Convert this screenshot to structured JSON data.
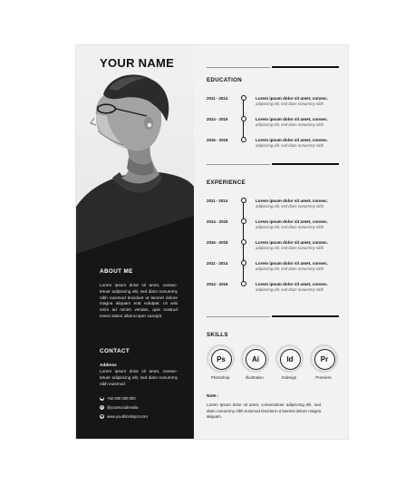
{
  "name": "YOUR NAME",
  "about": {
    "title": "ABOUT ME",
    "text": "Lorem ipsum dolor sit amet, consec-tetuer adipiscing elit, sed diam nonummy nibh euismod tincidunt ut laoreet dolore magna aliquam erat volutpat. Ut wisi enim ad minim veniam, quis nostrud exerci tation ullamcorper suscipit."
  },
  "contact": {
    "title": "CONTACT",
    "address_label": "Address",
    "address_text": "Lorem ipsum dolor sit amet, consec-tetuer adipiscing elit, sed diam nonummy nibh euismod",
    "phone": "+62 000 000 000",
    "social": "@yoursocialmedia",
    "website": "www.yourblockspot.com"
  },
  "education": {
    "title": "EDUCATION",
    "entries": [
      {
        "date": "2011 - 2014",
        "title": "Lorem ipsum dolor sit amet, consec.",
        "desc": "adipiscing elit, sed diam nonummy nibh"
      },
      {
        "date": "2014 - 2016",
        "title": "Lorem ipsum dolor sit amet, consec.",
        "desc": "adipiscing elit, sed diam nonummy nibh"
      },
      {
        "date": "2016 - 2018",
        "title": "Lorem ipsum dolor sit amet, consec.",
        "desc": "adipiscing elit, sed diam nonummy nibh"
      }
    ]
  },
  "experience": {
    "title": "EXPERIENCE",
    "entries": [
      {
        "date": "2011 - 2014",
        "title": "Lorem ipsum dolor sit amet, consec.",
        "desc": "adipiscing elit, sed diam nonummy nibh"
      },
      {
        "date": "2014 - 2016",
        "title": "Lorem ipsum dolor sit amet, consec.",
        "desc": "adipiscing elit, sed diam nonummy nibh"
      },
      {
        "date": "2016 - 2018",
        "title": "Lorem ipsum dolor sit amet, consec.",
        "desc": "adipiscing elit, sed diam nonummy nibh"
      },
      {
        "date": "2011 - 2014",
        "title": "Lorem ipsum dolor sit amet, consec.",
        "desc": "adipiscing elit, sed diam nonummy nibh"
      },
      {
        "date": "2014 - 2016",
        "title": "Lorem ipsum dolor sit amet, consec.",
        "desc": "adipiscing elit, sed diam nonummy nibh"
      }
    ]
  },
  "skills": {
    "title": "SKILLS",
    "items": [
      {
        "abbr": "Ps",
        "label": "Photoshop"
      },
      {
        "abbr": "Ai",
        "label": "Illustration"
      },
      {
        "abbr": "Id",
        "label": "Indesign"
      },
      {
        "abbr": "Pr",
        "label": "Premiere"
      }
    ]
  },
  "note": {
    "title": "Note :",
    "text": "Lorem ipsum dolor sit amet, consectetuer adipiscing elit, sed diam nonummy nibh euismod tincidunt ut laoreet dolore magna aliquam."
  },
  "colors": {
    "dark": "#161616",
    "light": "#f2f2f2",
    "accent": "#111111"
  },
  "icons": {
    "phone": "phone-icon",
    "social": "at-sign-icon",
    "website": "globe-icon"
  }
}
